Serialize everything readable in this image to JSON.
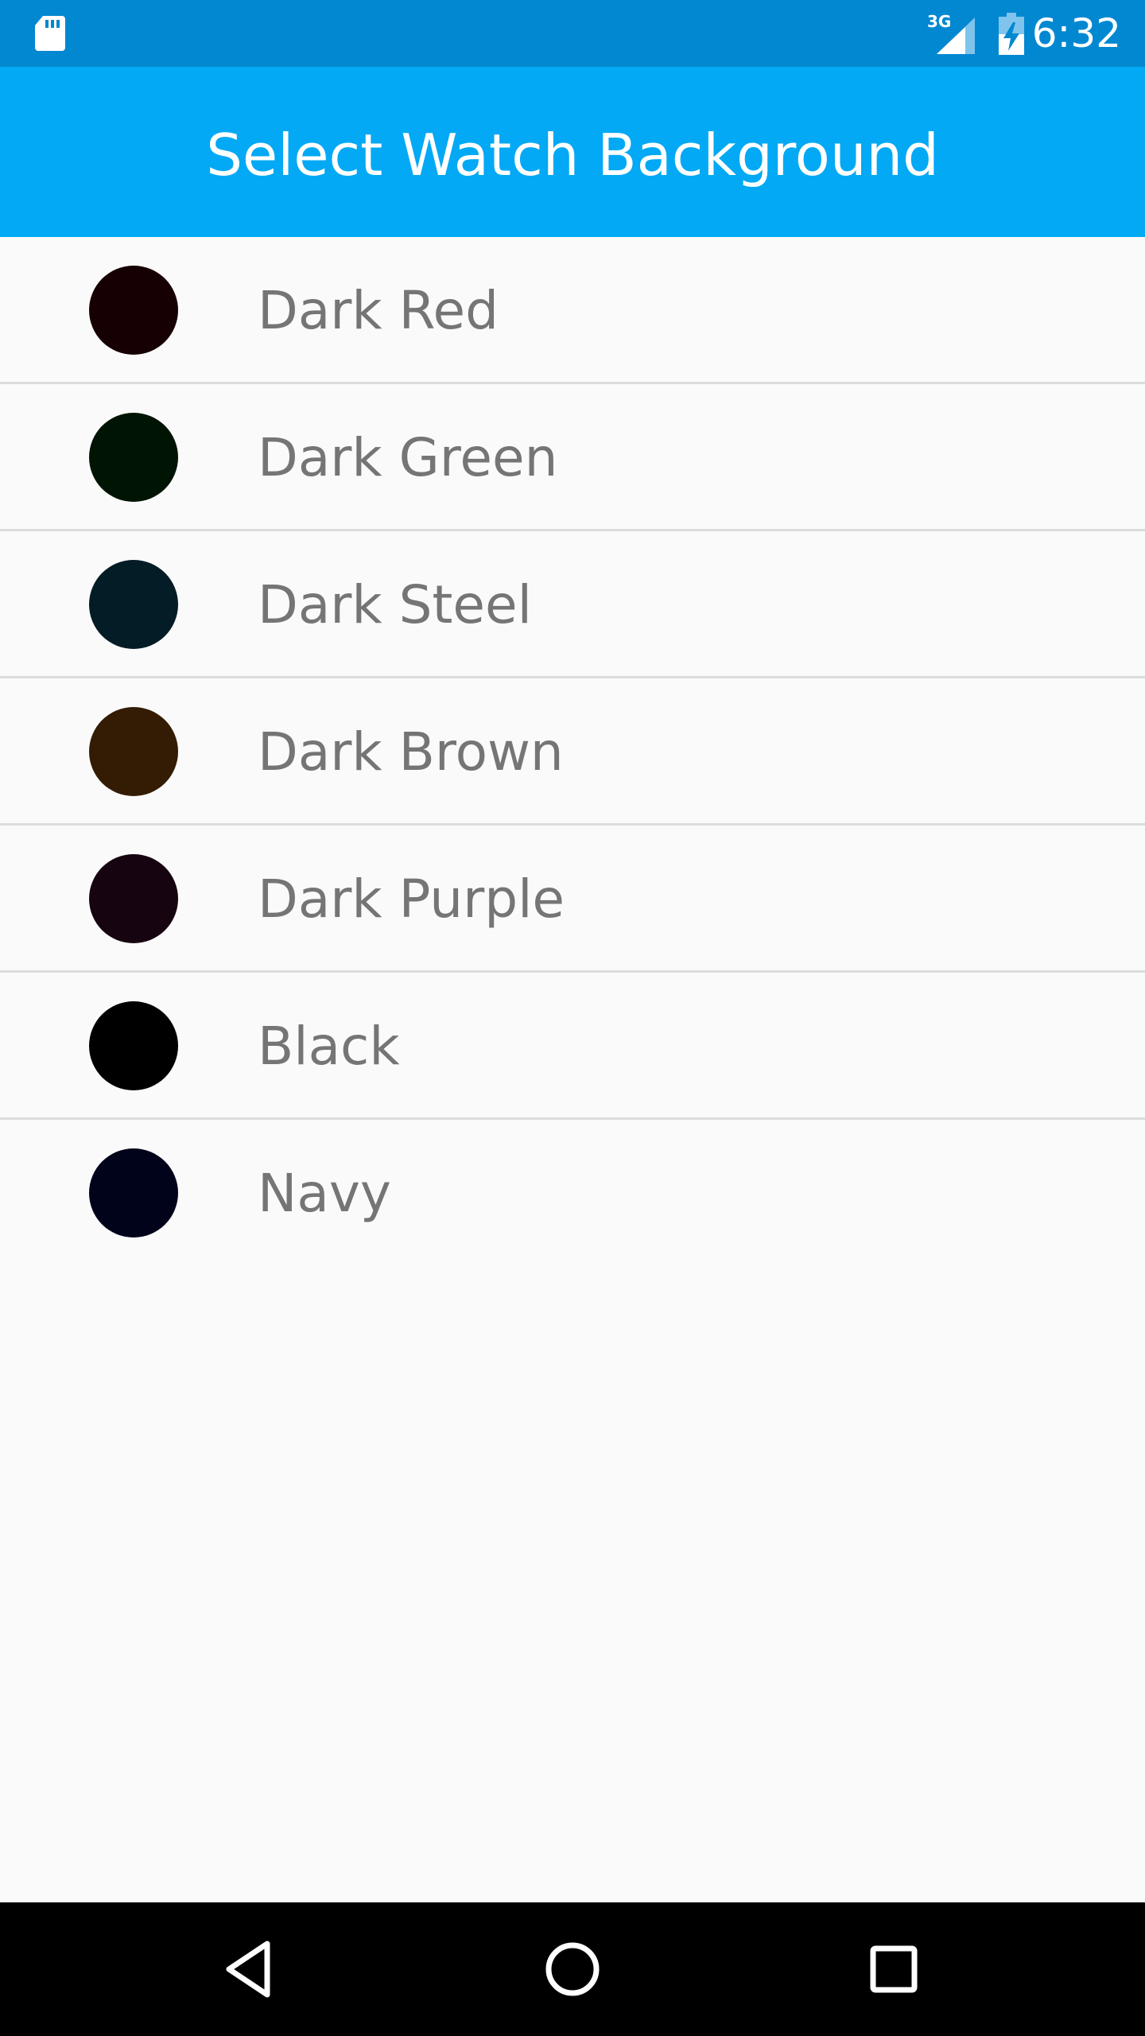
{
  "status_bar": {
    "time": "6:32",
    "network_label": "3G",
    "icons": [
      "sd-card-icon",
      "cell-signal-icon",
      "battery-charging-icon"
    ]
  },
  "app_bar": {
    "title": "Select Watch Background"
  },
  "colors": [
    {
      "label": "Dark Red",
      "swatch": "#170003"
    },
    {
      "label": "Dark Green",
      "swatch": "#001403"
    },
    {
      "label": "Dark Steel",
      "swatch": "#041c25"
    },
    {
      "label": "Dark Brown",
      "swatch": "#331c03"
    },
    {
      "label": "Dark Purple",
      "swatch": "#160510"
    },
    {
      "label": "Black",
      "swatch": "#000000"
    },
    {
      "label": "Navy",
      "swatch": "#01031b"
    }
  ],
  "theme": {
    "status_bar_color": "#0288d1",
    "app_bar_color": "#03a9f4",
    "background": "#fafafa",
    "label_color": "#757575",
    "divider_color": "#dcdcdc"
  },
  "nav_bar": {
    "buttons": [
      "back-icon",
      "home-icon",
      "recents-icon"
    ]
  }
}
